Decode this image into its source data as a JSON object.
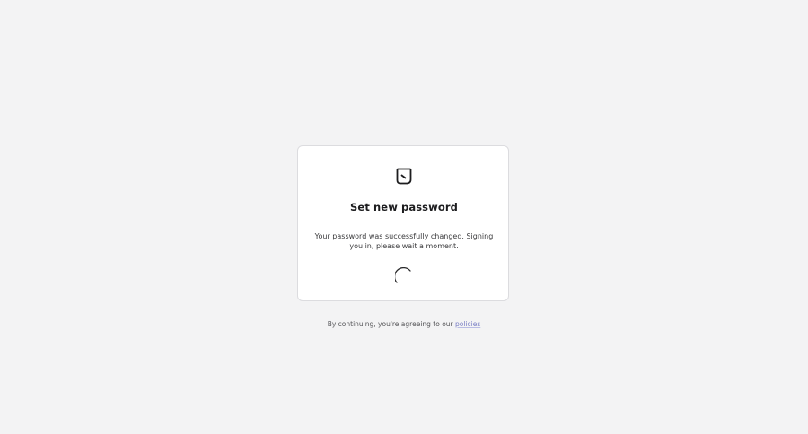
{
  "card": {
    "logo_icon": "app-logo-icon",
    "title": "Set new password",
    "message": "Your password was successfully changed. Signing you in, please wait a moment.",
    "spinner_icon": "loading-spinner-icon"
  },
  "footer": {
    "text": "By continuing, you're agreeing to our ",
    "link_label": "policies"
  },
  "colors": {
    "background": "#f3f3f4",
    "card": "#ffffff",
    "link": "#7a7fc4",
    "text": "#1f1f1f"
  }
}
